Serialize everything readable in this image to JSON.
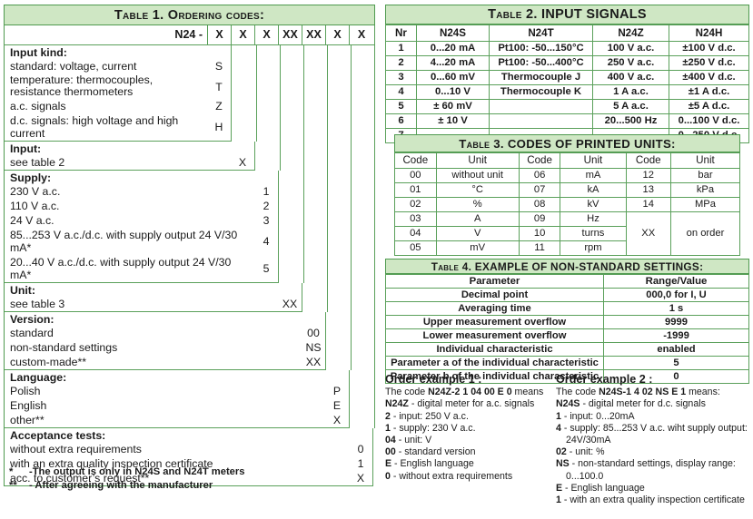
{
  "table1": {
    "title": "Table 1. Ordering codes:",
    "code_label": "N24 -",
    "code_columns": [
      "X",
      "X",
      "X",
      "XX",
      "XX",
      "X",
      "X"
    ],
    "sections": [
      {
        "heading": "Input kind:",
        "rows": [
          {
            "text": "standard: voltage, current",
            "code": "S"
          },
          {
            "text": "temperature: thermocouples, resistance thermometers",
            "code": "T"
          },
          {
            "text": "a.c. signals",
            "code": "Z"
          },
          {
            "text": "d.c. signals: high voltage and high current",
            "code": "H"
          }
        ]
      },
      {
        "heading": "Input:",
        "rows": [
          {
            "text": "see table 2",
            "code": "X"
          }
        ]
      },
      {
        "heading": "Supply:",
        "rows": [
          {
            "text": "230 V a.c.",
            "code": "1"
          },
          {
            "text": "110 V a.c.",
            "code": "2"
          },
          {
            "text": "24 V a.c.",
            "code": "3"
          },
          {
            "text": "85...253 V a.c./d.c. with supply output 24 V/30 mA*",
            "code": "4"
          },
          {
            "text": "20...40 V a.c./d.c. with supply output 24 V/30 mA*",
            "code": "5"
          }
        ]
      },
      {
        "heading": "Unit:",
        "rows": [
          {
            "text": "see table 3",
            "code": "XX"
          }
        ]
      },
      {
        "heading": "Version:",
        "rows": [
          {
            "text": "standard",
            "code": "00"
          },
          {
            "text": "non-standard settings",
            "code": "NS"
          },
          {
            "text": "custom-made**",
            "code": "XX"
          }
        ]
      },
      {
        "heading": "Language:",
        "rows": [
          {
            "text": "Polish",
            "code": "P"
          },
          {
            "text": "English",
            "code": "E"
          },
          {
            "text": "other**",
            "code": "X"
          }
        ]
      },
      {
        "heading": "Acceptance tests:",
        "rows": [
          {
            "text": "without extra requirements",
            "code": "0"
          },
          {
            "text": "with an extra quality inspection certificate",
            "code": "1"
          },
          {
            "text": "acc. to customer’s request**",
            "code": "X"
          }
        ]
      }
    ],
    "footnotes": [
      {
        "mark": "*",
        "text": "-The output is only in N24S and N24T meters"
      },
      {
        "mark": "**",
        "text": "- After agreeing with the manufacturer"
      }
    ]
  },
  "table2": {
    "title": "Table 2. INPUT SIGNALS",
    "headers": [
      "Nr",
      "N24S",
      "N24T",
      "N24Z",
      "N24H"
    ],
    "rows": [
      [
        "1",
        "0...20 mA",
        "Pt100: -50...150°C",
        "100 V a.c.",
        "±100 V d.c."
      ],
      [
        "2",
        "4...20 mA",
        "Pt100: -50...400°C",
        "250 V a.c.",
        "±250 V d.c."
      ],
      [
        "3",
        "0...60 mV",
        "Thermocouple J",
        "400 V a.c.",
        "±400 V d.c."
      ],
      [
        "4",
        "0...10 V",
        "Thermocouple K",
        "1 A a.c.",
        "±1 A d.c."
      ],
      [
        "5",
        "± 60 mV",
        "",
        "5 A a.c.",
        "±5 A d.c."
      ],
      [
        "6",
        "± 10 V",
        "",
        "20...500 Hz",
        "0...100 V d.c."
      ],
      [
        "7",
        "",
        "",
        "",
        "0...250 V d.c."
      ]
    ]
  },
  "table3": {
    "title": "Table 3. CODES OF PRINTED UNITS:",
    "headers": [
      "Code",
      "Unit",
      "Code",
      "Unit",
      "Code",
      "Unit"
    ],
    "rows": [
      [
        "00",
        "without unit",
        "06",
        "mA",
        "12",
        "bar"
      ],
      [
        "01",
        "°C",
        "07",
        "kA",
        "13",
        "kPa"
      ],
      [
        "02",
        "%",
        "08",
        "kV",
        "14",
        "MPa"
      ],
      [
        "03",
        "A",
        "09",
        "Hz"
      ],
      [
        "04",
        "V",
        "10",
        "turns"
      ],
      [
        "05",
        "mV",
        "11",
        "rpm"
      ]
    ],
    "merged_code": "XX",
    "merged_unit": "on order"
  },
  "table4": {
    "title": "Table 4. EXAMPLE OF NON-STANDARD SETTINGS:",
    "headers": [
      "Parameter",
      "Range/Value"
    ],
    "rows": [
      [
        "Decimal point",
        "000,0 for I, U"
      ],
      [
        "Averaging time",
        "1 s"
      ],
      [
        "Upper measurement overflow",
        "9999"
      ],
      [
        "Lower measurement overflow",
        "-1999"
      ],
      [
        "Individual characteristic",
        "enabled"
      ],
      [
        "Parameter a of the individual characteristic",
        "5"
      ],
      [
        "Parameter b of the individual characteristic",
        "0"
      ]
    ]
  },
  "example1": {
    "heading": "Order example 1 :",
    "intro_prefix": "The code ",
    "intro_code": "N24Z-2 1 04 00 E 0",
    "intro_suffix": " means",
    "lines": [
      {
        "code": "N24Z",
        "text": " - digital meter for a.c. signals"
      },
      {
        "code": "2",
        "text": " - input: 250 V a.c."
      },
      {
        "code": "1",
        "text": " - supply: 230 V a.c."
      },
      {
        "code": "04",
        "text": " - unit: V"
      },
      {
        "code": "00",
        "text": " - standard version"
      },
      {
        "code": "E",
        "text": " - English language"
      },
      {
        "code": "0",
        "text": " - without extra requirements"
      }
    ]
  },
  "example2": {
    "heading": "Order example 2 :",
    "intro_prefix": "The code ",
    "intro_code": "N24S-1 4 02 NS E 1",
    "intro_suffix": " means:",
    "lines": [
      {
        "code": "N24S",
        "text": " - digital meter for d.c. signals"
      },
      {
        "code": "1",
        "text": " - input: 0...20mA"
      },
      {
        "code": "4",
        "text": " - supply: 85...253 V a.c. wiht supply output:"
      },
      {
        "code": "",
        "text": "24V/30mA",
        "indent": true
      },
      {
        "code": "02",
        "text": " - unit: %"
      },
      {
        "code": "NS",
        "text": " - non-standard settings, display range:"
      },
      {
        "code": "",
        "text": "0...100.0",
        "indent": true
      },
      {
        "code": "E",
        "text": " - English language"
      },
      {
        "code": "1",
        "text": " - with an extra quality inspection certificate"
      }
    ]
  },
  "colors": {
    "header_fill": "#cfe7c4",
    "border_strong": "#4f9a4f",
    "border_light": "#5aa05a",
    "text": "#1a1a1a"
  }
}
